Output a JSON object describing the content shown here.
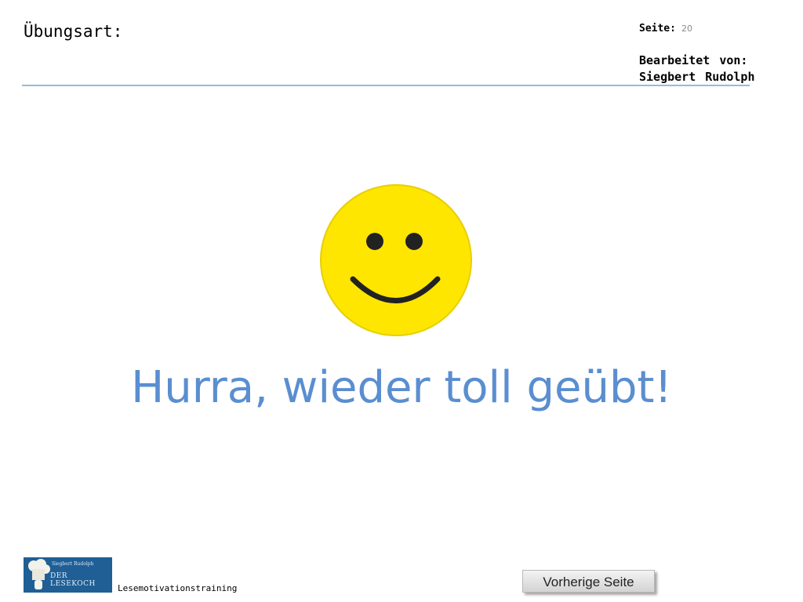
{
  "header": {
    "exercise_type_label": "Übungsart:",
    "page_label": "Seite:",
    "page_number": "20",
    "edited_by_label": "Bearbeitet von:",
    "author": "Siegbert Rudolph"
  },
  "main": {
    "headline": "Hurra, wieder toll geübt!",
    "icon": "smiley-face-icon",
    "smiley_color": "#ffe600",
    "headline_color": "#5a8ed0"
  },
  "footer": {
    "logo": {
      "author": "Siegbert Rudolph",
      "brand": "DER LESEKOCH",
      "icon": "chef-hat-icon"
    },
    "training_label": "Lesemotivationstraining",
    "prev_button_label": "Vorherige Seite"
  }
}
